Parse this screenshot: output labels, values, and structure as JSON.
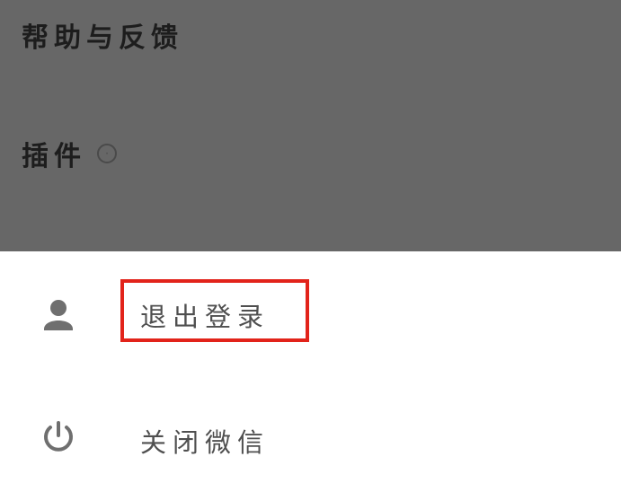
{
  "background_menu": {
    "help_feedback_label": "帮助与反馈",
    "plugins_label": "插件"
  },
  "action_sheet": {
    "logout_label": "退出登录",
    "close_wechat_label": "关闭微信"
  },
  "highlight": {
    "target": "logout",
    "color": "#e2231a"
  }
}
